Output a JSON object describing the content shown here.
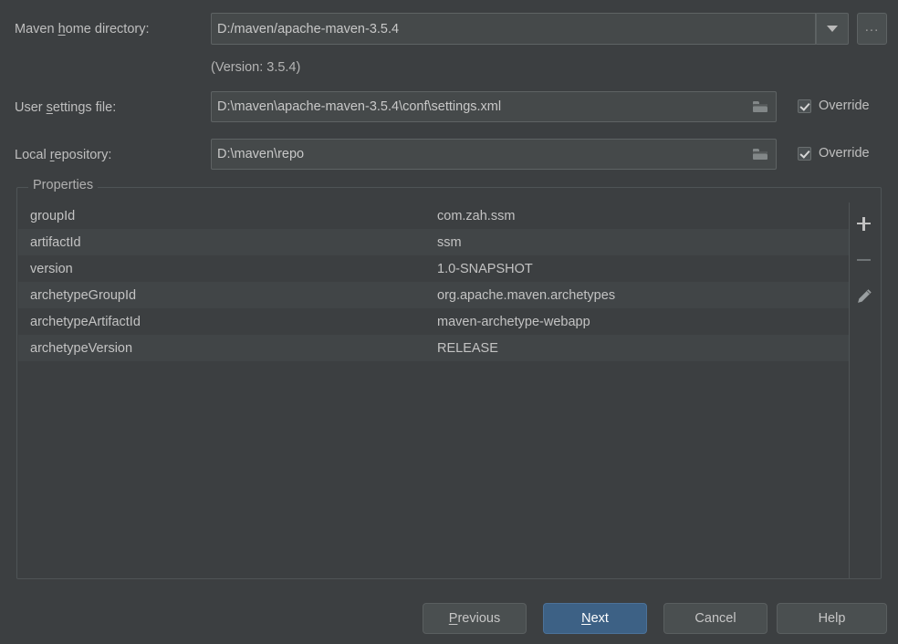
{
  "form": {
    "maven_home": {
      "label_pre": "Maven ",
      "label_mn": "h",
      "label_post": "ome directory:",
      "value": "D:/maven/apache-maven-3.5.4",
      "dropdown_icon": "chevron-down-icon",
      "browse_label": "...",
      "version_note": "(Version: 3.5.4)"
    },
    "user_settings": {
      "label_pre": "User ",
      "label_mn": "s",
      "label_post": "ettings file:",
      "value": "D:\\maven\\apache-maven-3.5.4\\conf\\settings.xml",
      "browse_icon": "folder-icon",
      "override_label": "Override",
      "override_checked": true
    },
    "local_repository": {
      "label_pre": "Local ",
      "label_mn": "r",
      "label_post": "epository:",
      "value": "D:\\maven\\repo",
      "browse_icon": "folder-icon",
      "override_label": "Override",
      "override_checked": true
    }
  },
  "properties": {
    "title": "Properties",
    "rows": [
      {
        "key": "groupId",
        "value": "com.zah.ssm"
      },
      {
        "key": "artifactId",
        "value": "ssm"
      },
      {
        "key": "version",
        "value": "1.0-SNAPSHOT"
      },
      {
        "key": "archetypeGroupId",
        "value": "org.apache.maven.archetypes"
      },
      {
        "key": "archetypeArtifactId",
        "value": "maven-archetype-webapp"
      },
      {
        "key": "archetypeVersion",
        "value": "RELEASE"
      }
    ],
    "toolbar": {
      "add_icon": "plus-icon",
      "remove_icon": "minus-icon",
      "edit_icon": "pencil-icon"
    }
  },
  "footer": {
    "previous": {
      "pre": "",
      "mn": "P",
      "post": "revious"
    },
    "next": {
      "pre": "",
      "mn": "N",
      "post": "ext"
    },
    "cancel": "Cancel",
    "help": "Help"
  },
  "colors": {
    "window_bg": "#3c3f41",
    "field_bg": "#45494a",
    "row_alt_bg": "#414547",
    "accent_blue": "#3d6185",
    "text": "#bfbfbf"
  }
}
